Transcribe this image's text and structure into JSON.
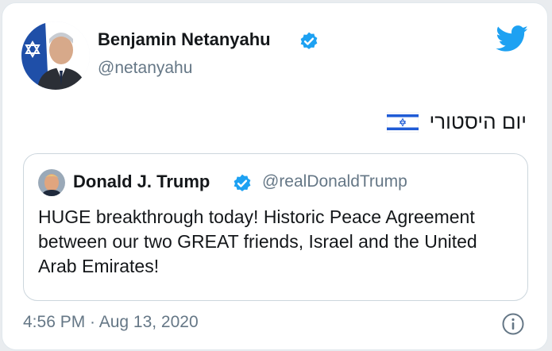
{
  "tweet": {
    "author": {
      "name": "Benjamin Netanyahu",
      "handle": "@netanyahu",
      "verified": true,
      "avatar_icon": "profile-photo-icon"
    },
    "text": "יום היסטורי",
    "flag_icon": "israel-flag-icon",
    "brand_icon": "twitter-bird-icon",
    "quoted": {
      "name": "Donald J. Trump",
      "handle": "@realDonaldTrump",
      "verified": true,
      "text": "HUGE breakthrough today! Historic Peace Agreement between our two GREAT friends, Israel and the United Arab Emirates!"
    },
    "timestamp": "4:56 PM · Aug 13, 2020",
    "info_icon": "info-icon"
  },
  "colors": {
    "twitter_blue": "#1da1f2",
    "text_primary": "#14171a",
    "text_secondary": "#657786",
    "border": "#ccd6dd"
  }
}
